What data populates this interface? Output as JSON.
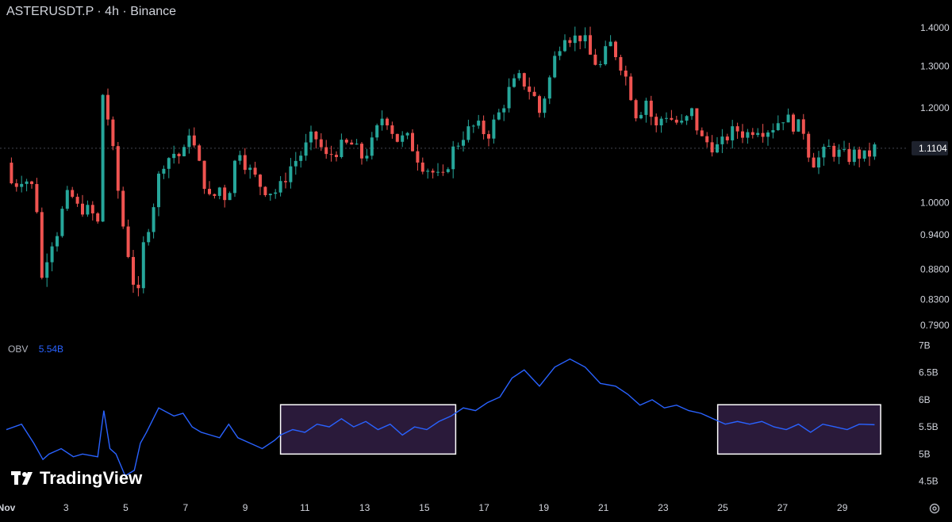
{
  "header": {
    "title": "ASTERUSDT.P · 4h · Binance"
  },
  "indicator": {
    "name": "OBV",
    "value": "5.54B"
  },
  "branding": {
    "logo_text": "TradingView"
  },
  "colors": {
    "background": "#000000",
    "up": "#26a69a",
    "down": "#ef5350",
    "obv_line": "#2962ff",
    "highlight_fill": "#2a1a3a",
    "highlight_stroke": "#ffffff",
    "text": "#d1d4dc"
  },
  "icons": {
    "settings": "settings-icon",
    "logo": "tradingview-logo-icon"
  },
  "chart_data": [
    {
      "type": "candlestick",
      "title": "ASTERUSDT.P · 4h · Binance",
      "x_ticks": [
        "Nov",
        "3",
        "5",
        "7",
        "9",
        "11",
        "13",
        "15",
        "17",
        "19",
        "21",
        "23",
        "25",
        "27",
        "29"
      ],
      "y_ticks": [
        "1.4000",
        "1.3000",
        "1.2000",
        "1.0000",
        "0.9400",
        "0.8800",
        "0.8300",
        "0.7900"
      ],
      "y_range": [
        0.79,
        1.4
      ],
      "y_scale": "log",
      "last_price": "1.1104",
      "x_range_days": [
        0,
        28.5
      ],
      "up_color": "#26a69a",
      "down_color": "#ef5350",
      "close_anchors": [
        [
          0,
          1.08
        ],
        [
          0.2,
          1.03
        ],
        [
          0.5,
          1.05
        ],
        [
          0.8,
          1.04
        ],
        [
          1.0,
          0.99
        ],
        [
          1.15,
          0.86
        ],
        [
          1.4,
          0.92
        ],
        [
          1.7,
          0.95
        ],
        [
          1.9,
          1.0
        ],
        [
          2.1,
          1.02
        ],
        [
          2.3,
          0.99
        ],
        [
          2.5,
          0.99
        ],
        [
          2.8,
          0.98
        ],
        [
          3.0,
          0.96
        ],
        [
          3.05,
          1.24
        ],
        [
          3.2,
          1.23
        ],
        [
          3.4,
          1.15
        ],
        [
          3.6,
          1.05
        ],
        [
          3.85,
          0.95
        ],
        [
          4.1,
          0.88
        ],
        [
          4.3,
          0.82
        ],
        [
          4.5,
          0.92
        ],
        [
          4.8,
          0.99
        ],
        [
          5.1,
          1.08
        ],
        [
          5.5,
          1.1
        ],
        [
          5.8,
          1.09
        ],
        [
          6.0,
          1.15
        ],
        [
          6.3,
          1.08
        ],
        [
          6.7,
          1.0
        ],
        [
          7.0,
          1.03
        ],
        [
          7.2,
          1.01
        ],
        [
          7.4,
          1.04
        ],
        [
          7.6,
          1.12
        ],
        [
          7.9,
          1.07
        ],
        [
          8.4,
          1.03
        ],
        [
          8.8,
          1.02
        ],
        [
          9.0,
          1.03
        ],
        [
          9.3,
          1.07
        ],
        [
          9.7,
          1.1
        ],
        [
          10.1,
          1.14
        ],
        [
          10.5,
          1.09
        ],
        [
          10.9,
          1.11
        ],
        [
          11.3,
          1.12
        ],
        [
          11.7,
          1.09
        ],
        [
          12.0,
          1.12
        ],
        [
          12.4,
          1.19
        ],
        [
          12.8,
          1.13
        ],
        [
          13.2,
          1.13
        ],
        [
          13.6,
          1.08
        ],
        [
          14.0,
          1.06
        ],
        [
          14.3,
          1.04
        ],
        [
          14.6,
          1.1
        ],
        [
          15.0,
          1.14
        ],
        [
          15.4,
          1.16
        ],
        [
          15.8,
          1.14
        ],
        [
          16.2,
          1.19
        ],
        [
          16.5,
          1.24
        ],
        [
          16.8,
          1.27
        ],
        [
          17.0,
          1.26
        ],
        [
          17.3,
          1.23
        ],
        [
          17.5,
          1.19
        ],
        [
          17.8,
          1.26
        ],
        [
          18.0,
          1.32
        ],
        [
          18.3,
          1.39
        ],
        [
          18.6,
          1.37
        ],
        [
          18.9,
          1.38
        ],
        [
          19.2,
          1.32
        ],
        [
          19.5,
          1.3
        ],
        [
          19.8,
          1.36
        ],
        [
          20.1,
          1.32
        ],
        [
          20.4,
          1.26
        ],
        [
          20.7,
          1.18
        ],
        [
          21.0,
          1.22
        ],
        [
          21.3,
          1.15
        ],
        [
          21.6,
          1.19
        ],
        [
          21.9,
          1.17
        ],
        [
          22.2,
          1.16
        ],
        [
          22.5,
          1.19
        ],
        [
          22.8,
          1.13
        ],
        [
          23.1,
          1.12
        ],
        [
          23.4,
          1.11
        ],
        [
          23.7,
          1.14
        ],
        [
          24.0,
          1.15
        ],
        [
          24.3,
          1.14
        ],
        [
          24.6,
          1.16
        ],
        [
          24.9,
          1.15
        ],
        [
          25.2,
          1.16
        ],
        [
          25.5,
          1.18
        ],
        [
          25.9,
          1.16
        ],
        [
          26.2,
          1.15
        ],
        [
          26.4,
          1.08
        ],
        [
          26.7,
          1.09
        ],
        [
          27.0,
          1.11
        ],
        [
          27.3,
          1.1
        ],
        [
          27.6,
          1.09
        ],
        [
          27.9,
          1.1
        ],
        [
          28.2,
          1.09
        ],
        [
          28.5,
          1.11
        ]
      ]
    },
    {
      "type": "line",
      "name": "OBV",
      "current_value": "5.54B",
      "y_ticks": [
        "7B",
        "6.5B",
        "6B",
        "5.5B",
        "5B",
        "4.5B"
      ],
      "y_range": [
        4.45,
        7.05
      ],
      "unit": "B",
      "x": [
        0,
        0.5,
        0.9,
        1.2,
        1.4,
        1.8,
        2.2,
        2.5,
        3.0,
        3.2,
        3.4,
        3.6,
        3.9,
        4.2,
        4.4,
        4.6,
        5.0,
        5.5,
        5.8,
        6.1,
        6.4,
        6.7,
        7.0,
        7.3,
        7.6,
        8.0,
        8.4,
        8.8,
        9.0,
        9.4,
        9.8,
        10.2,
        10.6,
        11.0,
        11.4,
        11.8,
        12.2,
        12.6,
        13.0,
        13.4,
        13.8,
        14.2,
        14.6,
        15.0,
        15.4,
        15.8,
        16.2,
        16.6,
        17.0,
        17.5,
        18.0,
        18.5,
        19.0,
        19.5,
        20.0,
        20.4,
        20.8,
        21.2,
        21.6,
        22.0,
        22.4,
        22.8,
        23.2,
        23.6,
        24.0,
        24.4,
        24.8,
        25.2,
        25.6,
        26.0,
        26.4,
        26.8,
        27.2,
        27.6,
        28.0,
        28.5
      ],
      "y": [
        5.45,
        5.55,
        5.2,
        4.9,
        5.0,
        5.1,
        4.95,
        5.0,
        4.95,
        5.8,
        5.1,
        5.0,
        4.6,
        4.7,
        5.2,
        5.4,
        5.85,
        5.7,
        5.75,
        5.5,
        5.4,
        5.35,
        5.3,
        5.55,
        5.3,
        5.2,
        5.1,
        5.25,
        5.35,
        5.45,
        5.4,
        5.55,
        5.5,
        5.65,
        5.5,
        5.6,
        5.45,
        5.55,
        5.35,
        5.5,
        5.45,
        5.6,
        5.7,
        5.85,
        5.8,
        5.95,
        6.05,
        6.4,
        6.55,
        6.25,
        6.6,
        6.75,
        6.6,
        6.3,
        6.25,
        6.1,
        5.9,
        6.0,
        5.85,
        5.9,
        5.8,
        5.75,
        5.65,
        5.55,
        5.6,
        5.55,
        5.6,
        5.5,
        5.45,
        5.55,
        5.4,
        5.55,
        5.5,
        5.45,
        5.55,
        5.54
      ]
    }
  ]
}
